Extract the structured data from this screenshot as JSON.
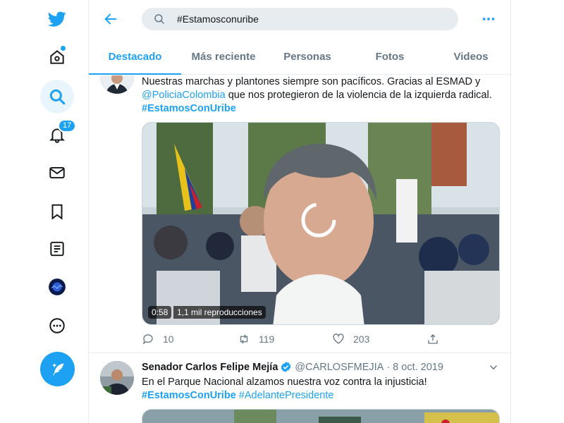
{
  "search": {
    "value": "#Estamosconuribe"
  },
  "rail": {
    "notifications_count": "17"
  },
  "tabs": [
    "Destacado",
    "Más reciente",
    "Personas",
    "Fotos",
    "Videos"
  ],
  "tweet1": {
    "text_pre": "Nuestras marchas y plantones siempre son pacíficos. Gracias al ESMAD y ",
    "mention": "@PoliciaColombia",
    "text_mid": " que nos protegieron de la violencia de la izquierda radical. ",
    "hashtag": "#EstamosConUribe",
    "video": {
      "duration": "0:58",
      "views": "1,1 mil reproducciones"
    },
    "replies": "10",
    "retweets": "119",
    "likes": "203"
  },
  "tweet2": {
    "name": "Senador Carlos Felipe Mejía",
    "handle": "@CARLOSFMEJIA",
    "separator": "·",
    "date": "8 oct. 2019",
    "text": "En el Parque Nacional alzamos nuestra voz contra la injusticia!",
    "hashtag1": "#EstamosConUribe",
    "hashtag2": "#AdelantePresidente"
  },
  "colors": {
    "accent": "#1da1f2",
    "secondary_text": "#657786",
    "border": "#e6ecf0"
  }
}
